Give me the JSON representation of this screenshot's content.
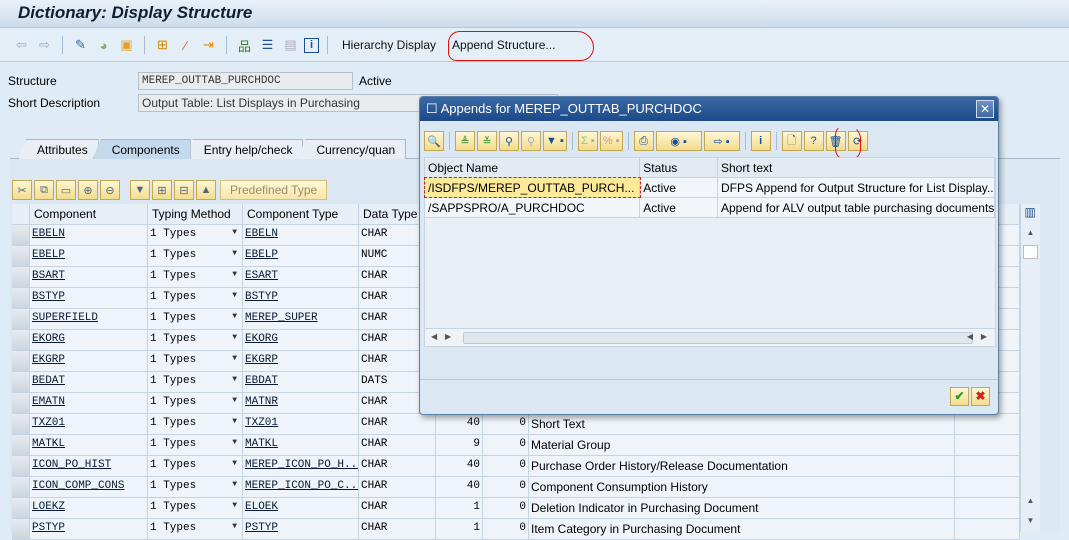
{
  "title": "Dictionary: Display Structure",
  "toolbar": {
    "icons": [
      "back-icon",
      "forward-icon",
      "display-change-icon",
      "activate-icon",
      "other-object-icon",
      "where-used-icon",
      "magic-wand-icon",
      "navigate-icon",
      "hierarchy-icon",
      "indent-icon",
      "list-icon",
      "info-icon"
    ],
    "hierarchy_display": "Hierarchy Display",
    "append_structure": "Append Structure..."
  },
  "header": {
    "structure_label": "Structure",
    "structure_value": "MEREP_OUTTAB_PURCHDOC",
    "status": "Active",
    "short_desc_label": "Short Description",
    "short_desc_value": "Output Table: List Displays in Purchasing"
  },
  "tabs": [
    "Attributes",
    "Components",
    "Entry help/check",
    "Currency/quan"
  ],
  "active_tab": "Components",
  "components_toolbar": {
    "predefined_type": "Predefined Type"
  },
  "grid": {
    "headers": [
      "Component",
      "Typing Method",
      "Component Type",
      "Data Type",
      "",
      "",
      "",
      ""
    ],
    "rows": [
      {
        "component": "EBELN",
        "typing": "1 Types",
        "type": "EBELN",
        "dtype": "CHAR",
        "len": "",
        "dec": "",
        "desc": ""
      },
      {
        "component": "EBELP",
        "typing": "1 Types",
        "type": "EBELP",
        "dtype": "NUMC",
        "len": "",
        "dec": "",
        "desc": ""
      },
      {
        "component": "BSART",
        "typing": "1 Types",
        "type": "ESART",
        "dtype": "CHAR",
        "len": "",
        "dec": "",
        "desc": ""
      },
      {
        "component": "BSTYP",
        "typing": "1 Types",
        "type": "BSTYP",
        "dtype": "CHAR",
        "len": "",
        "dec": "",
        "desc": ""
      },
      {
        "component": "SUPERFIELD",
        "typing": "1 Types",
        "type": "MEREP_SUPER",
        "dtype": "CHAR",
        "len": "",
        "dec": "",
        "desc": ""
      },
      {
        "component": "EKORG",
        "typing": "1 Types",
        "type": "EKORG",
        "dtype": "CHAR",
        "len": "",
        "dec": "",
        "desc": ""
      },
      {
        "component": "EKGRP",
        "typing": "1 Types",
        "type": "EKGRP",
        "dtype": "CHAR",
        "len": "",
        "dec": "",
        "desc": ""
      },
      {
        "component": "BEDAT",
        "typing": "1 Types",
        "type": "EBDAT",
        "dtype": "DATS",
        "len": "",
        "dec": "",
        "desc": ""
      },
      {
        "component": "EMATN",
        "typing": "1 Types",
        "type": "MATNR",
        "dtype": "CHAR",
        "len": "",
        "dec": "",
        "desc": ""
      },
      {
        "component": "TXZ01",
        "typing": "1 Types",
        "type": "TXZ01",
        "dtype": "CHAR",
        "len": "40",
        "dec": "0",
        "desc": "Short Text"
      },
      {
        "component": "MATKL",
        "typing": "1 Types",
        "type": "MATKL",
        "dtype": "CHAR",
        "len": "9",
        "dec": "0",
        "desc": "Material Group"
      },
      {
        "component": "ICON_PO_HIST",
        "typing": "1 Types",
        "type": "MEREP_ICON_PO_H...",
        "dtype": "CHAR",
        "len": "40",
        "dec": "0",
        "desc": "Purchase Order History/Release Documentation"
      },
      {
        "component": "ICON_COMP_CONS",
        "typing": "1 Types",
        "type": "MEREP_ICON_PO_C...",
        "dtype": "CHAR",
        "len": "40",
        "dec": "0",
        "desc": "Component Consumption History"
      },
      {
        "component": "LOEKZ",
        "typing": "1 Types",
        "type": "ELOEK",
        "dtype": "CHAR",
        "len": "1",
        "dec": "0",
        "desc": "Deletion Indicator in Purchasing Document"
      },
      {
        "component": "PSTYP",
        "typing": "1 Types",
        "type": "PSTYP",
        "dtype": "CHAR",
        "len": "1",
        "dec": "0",
        "desc": "Item Category in Purchasing Document"
      }
    ]
  },
  "dialog": {
    "title": "Appends for MEREP_OUTTAB_PURCHDOC",
    "headers": [
      "Object Name",
      "Status",
      "Short text"
    ],
    "rows": [
      {
        "name": "/ISDFPS/MEREP_OUTTAB_PURCH...",
        "status": "Active",
        "text": "DFPS Append for Output Structure for List Display..."
      },
      {
        "name": "/SAPPSPRO/A_PURCHDOC",
        "status": "Active",
        "text": "Append for ALV output table purchasing documents"
      }
    ]
  },
  "colors": {
    "title_bar": "#1c4987",
    "annotation": "#e01010",
    "selected_row": "#fde99a"
  }
}
